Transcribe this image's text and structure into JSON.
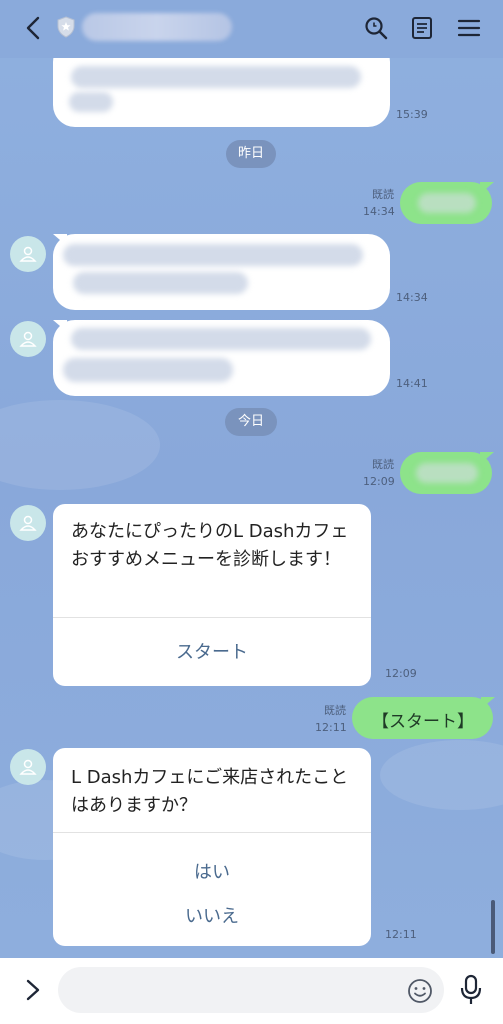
{
  "header": {
    "back_icon": "chevron-left-icon",
    "search_icon": "search-icon",
    "notes_icon": "notes-icon",
    "menu_icon": "menu-icon"
  },
  "messages": {
    "m1_time": "15:39",
    "date_yesterday": "昨日",
    "m2_read": "既読",
    "m2_time": "14:34",
    "m3_time": "14:34",
    "m4_time": "14:41",
    "date_today": "今日",
    "m5_read": "既読",
    "m5_time": "12:09",
    "m6_text": "あなたにぴったりのL Dashカフェおすすめメニューを診断します！",
    "m6_action": "スタート",
    "m6_time": "12:09",
    "m7_read": "既読",
    "m7_time": "12:11",
    "m7_text": "【スタート】",
    "m8_text": "L Dashカフェにご来店されたことはありますか？",
    "m8_action_yes": "はい",
    "m8_action_no": "いいえ",
    "m8_time": "12:11"
  },
  "colors": {
    "chat_bg": "#8aa9d9",
    "outgoing_bubble": "#8de38a",
    "incoming_bubble": "#ffffff",
    "action_text": "#4a6a8e"
  }
}
